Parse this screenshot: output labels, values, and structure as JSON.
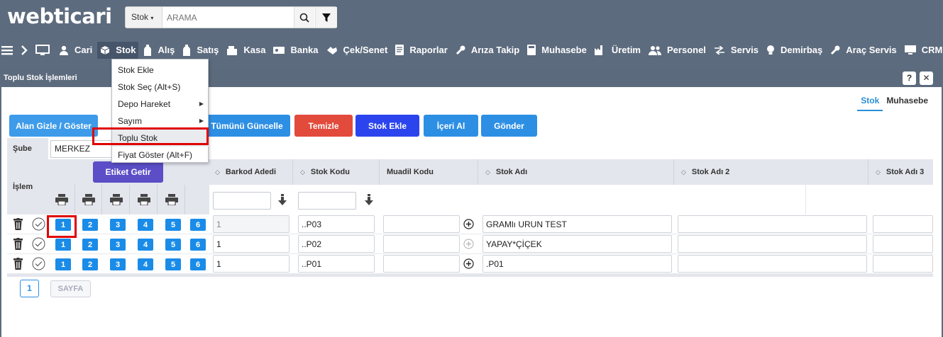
{
  "brand": {
    "logo_text": "webticari"
  },
  "search": {
    "scope_label": "Stok",
    "placeholder": "ARAMA"
  },
  "menu": [
    {
      "label": "Cari",
      "icon": "user-icon"
    },
    {
      "label": "Stok",
      "icon": "box-icon",
      "active": true
    },
    {
      "label": "Alış",
      "icon": "bottle-icon"
    },
    {
      "label": "Satış",
      "icon": "bottle-icon"
    },
    {
      "label": "Kasa",
      "icon": "cash-register-icon"
    },
    {
      "label": "Banka",
      "icon": "bank-card-icon"
    },
    {
      "label": "Çek/Senet",
      "icon": "handshake-icon"
    },
    {
      "label": "Raporlar",
      "icon": "report-icon"
    },
    {
      "label": "Arıza Takip",
      "icon": "wrench-icon"
    },
    {
      "label": "Muhasebe",
      "icon": "calculator-icon"
    },
    {
      "label": "Üretim",
      "icon": "factory-icon"
    },
    {
      "label": "Personel",
      "icon": "users-icon"
    },
    {
      "label": "Servis",
      "icon": "arrows-icon"
    },
    {
      "label": "Demirbaş",
      "icon": "bulb-icon"
    },
    {
      "label": "Araç Servis",
      "icon": "wrench-icon"
    },
    {
      "label": "CRM",
      "icon": "monitor-icon"
    }
  ],
  "window": {
    "title": "Toplu Stok İşlemleri",
    "help_label": "?",
    "close_label": "✕"
  },
  "module_tabs": [
    {
      "label": "Stok",
      "active": true
    },
    {
      "label": "Muhasebe",
      "active": false
    }
  ],
  "actions": {
    "toggle_fields": "Alan Gizle / Göster",
    "update_all": "Tümünü Güncelle",
    "clear": "Temizle",
    "add_stock": "Stok Ekle",
    "import": "İçeri Al",
    "send": "Gönder",
    "label_print": "Etiket Getir"
  },
  "branch": {
    "label": "Şube",
    "value": "MERKEZ"
  },
  "table": {
    "action_header": "İşlem",
    "columns": [
      "Barkod Adedi",
      "Stok Kodu",
      "Muadil Kodu",
      "Stok Adı",
      "Stok Adı 2",
      "Stok Adı 3"
    ],
    "print_labels": [
      "1",
      "2",
      "3",
      "4",
      "5",
      "6"
    ],
    "rows": [
      {
        "barcode_qty": "1",
        "stock_code": "..P03",
        "alt_code": "",
        "name": "GRAMlı URUN TEST",
        "name2": "",
        "name3": ""
      },
      {
        "barcode_qty": "1",
        "stock_code": "..P02",
        "alt_code": "",
        "name": "YAPAY*ÇİÇEK",
        "name2": "",
        "name3": ""
      },
      {
        "barcode_qty": "1",
        "stock_code": "..P01",
        "alt_code": "",
        "name": ".P01",
        "name2": "",
        "name3": ""
      }
    ]
  },
  "pager": {
    "current": "1",
    "page_label": "SAYFA"
  },
  "dropdown": {
    "items": [
      {
        "label": "Stok Ekle",
        "submenu": false
      },
      {
        "label": "Stok Seç (Alt+S)",
        "submenu": false
      },
      {
        "label": "Depo Hareket",
        "submenu": true
      },
      {
        "label": "Sayım",
        "submenu": true
      },
      {
        "label": "Toplu Stok",
        "submenu": false,
        "highlighted": true
      },
      {
        "label": "Fiyat Göster (Alt+F)",
        "submenu": false
      }
    ]
  },
  "colors": {
    "topbar": "#5d6b7e",
    "accent_blue": "#2d8fe4",
    "danger_red": "#e24a3b",
    "purple": "#5b4ec6",
    "highlight_red": "#e00000"
  }
}
